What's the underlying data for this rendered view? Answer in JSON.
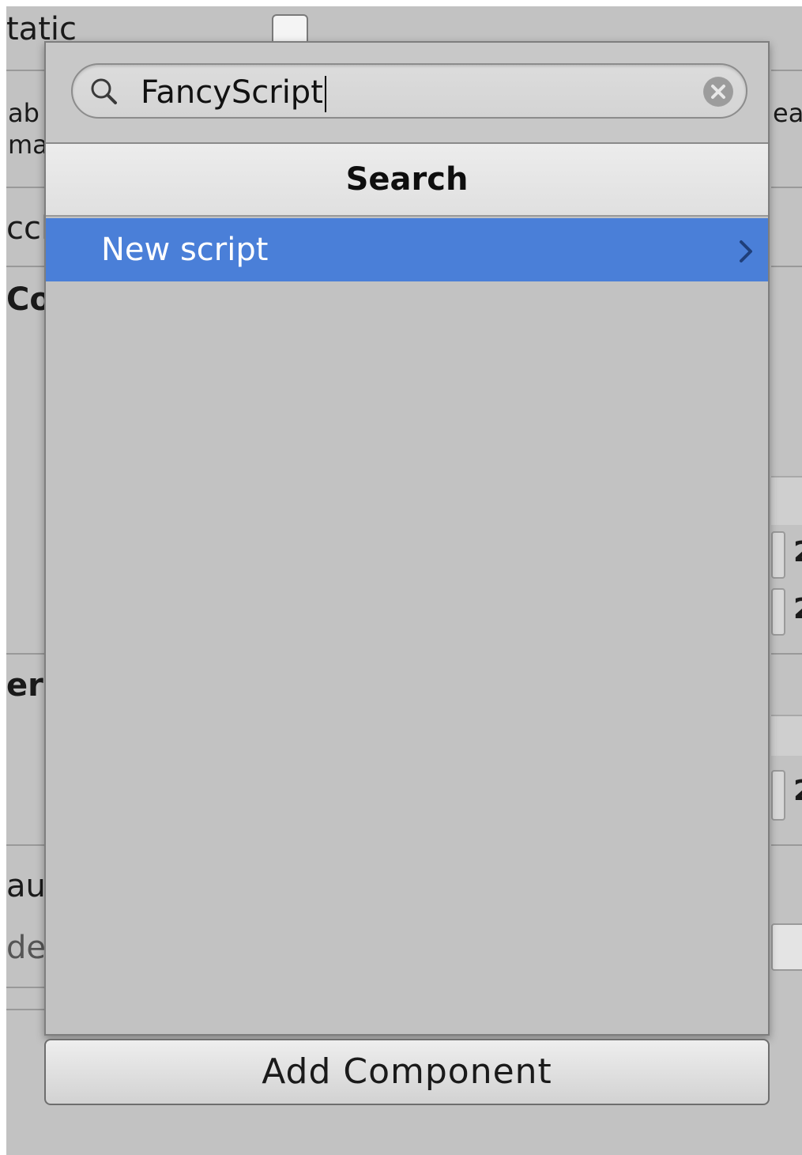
{
  "background": {
    "fragments": [
      {
        "id": "static-label",
        "text": "tatic"
      },
      {
        "id": "enable-frag",
        "text": "ab"
      },
      {
        "id": "ma-frag",
        "text": "ma"
      },
      {
        "id": "ea-frag",
        "text": "ea"
      },
      {
        "id": "occl-frag",
        "text": "ccl"
      },
      {
        "id": "co-frag",
        "text": "Co"
      },
      {
        "id": "er-frag",
        "text": "er"
      },
      {
        "id": "fau-frag",
        "text": "au"
      },
      {
        "id": "de-frag",
        "text": "de"
      },
      {
        "id": "right-num-1",
        "text": "2"
      },
      {
        "id": "right-num-2",
        "text": "2"
      },
      {
        "id": "right-num-3",
        "text": "2"
      }
    ]
  },
  "popup": {
    "search": {
      "value": "FancyScript",
      "icon": "magnifier-icon",
      "clear_icon": "clear-circle-x-icon"
    },
    "header": {
      "title": "Search"
    },
    "results": [
      {
        "label": "New script",
        "selected": true,
        "has_submenu": true
      }
    ],
    "colors": {
      "selection": "#4a7fd8",
      "panel": "#c2c2c2"
    }
  },
  "add_component": {
    "label": "Add Component"
  }
}
